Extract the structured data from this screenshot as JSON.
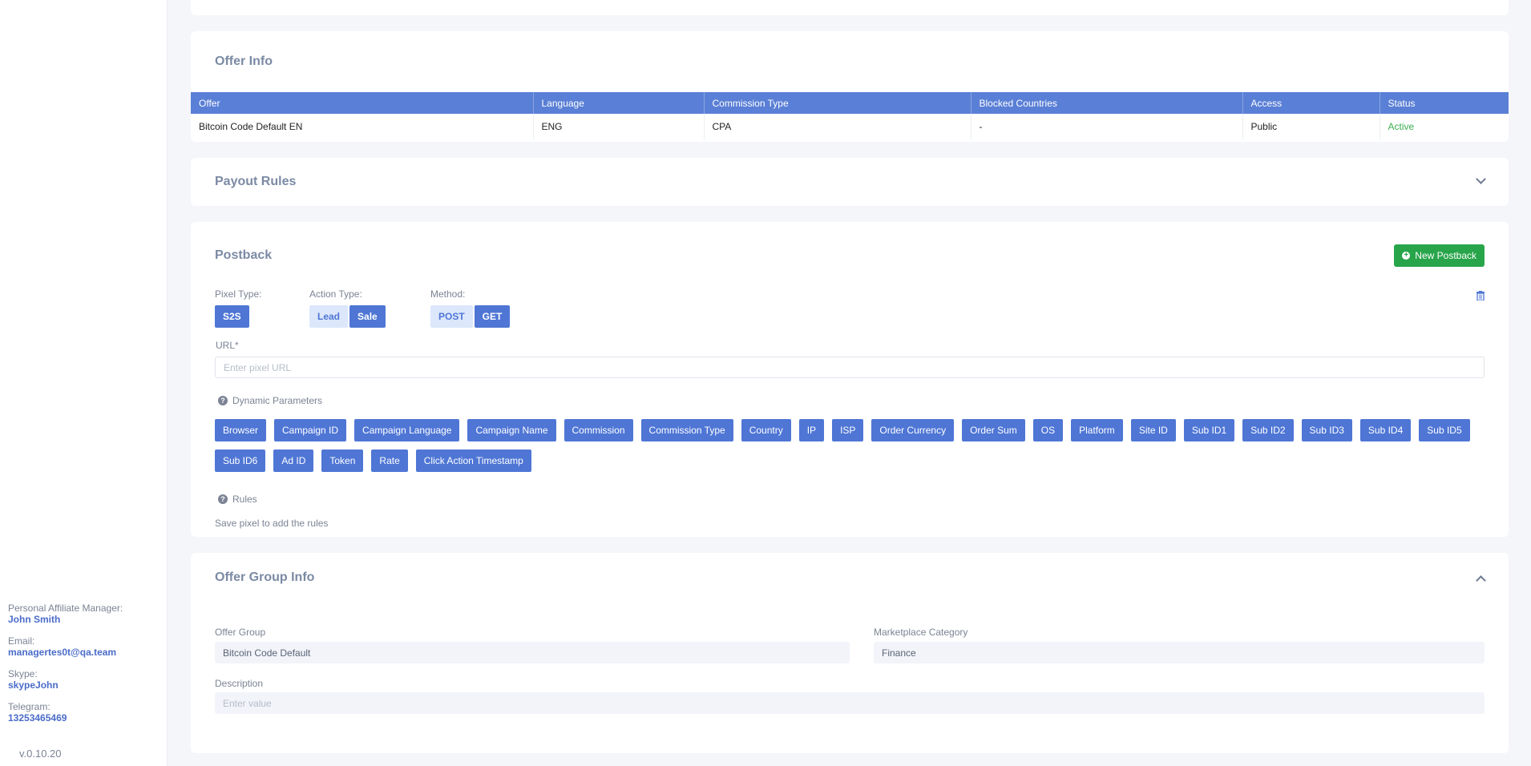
{
  "sidebar": {
    "manager": [
      {
        "label": "Personal Affiliate Manager:",
        "value": "John Smith"
      },
      {
        "label": "Email:",
        "value": "managertes0t@qa.team"
      },
      {
        "label": "Skype:",
        "value": "skypeJohn"
      },
      {
        "label": "Telegram:",
        "value": "13253465469"
      }
    ],
    "version": "v.0.10.20"
  },
  "offer_info": {
    "title": "Offer Info",
    "columns": [
      "Offer",
      "Language",
      "Commission Type",
      "Blocked Countries",
      "Access",
      "Status"
    ],
    "row": [
      "Bitcoin Code Default EN",
      "ENG",
      "CPA",
      "-",
      "Public",
      "Active"
    ],
    "status_color": "#3cae4f"
  },
  "payout_rules": {
    "title": "Payout Rules",
    "icon": "chevron-down-icon"
  },
  "postback": {
    "title": "Postback",
    "new_button": "New Postback",
    "pixel_type_label": "Pixel Type:",
    "pixel_type_options": [
      "S2S"
    ],
    "action_type_label": "Action Type:",
    "action_type_options": [
      "Lead",
      "Sale"
    ],
    "action_type_selected": "Sale",
    "method_label": "Method:",
    "method_options": [
      "POST",
      "GET"
    ],
    "method_selected": "GET",
    "url_label": "URL*",
    "url_placeholder": "Enter pixel URL",
    "url_value": "",
    "dynamic_params_label": "Dynamic Parameters",
    "dynamic_params": [
      "Browser",
      "Campaign ID",
      "Campaign Language",
      "Campaign Name",
      "Commission",
      "Commission Type",
      "Country",
      "IP",
      "ISP",
      "Order Currency",
      "Order Sum",
      "OS",
      "Platform",
      "Site ID",
      "Sub ID1",
      "Sub ID2",
      "Sub ID3",
      "Sub ID4",
      "Sub ID5",
      "Sub ID6",
      "Ad ID",
      "Token",
      "Rate",
      "Click Action Timestamp"
    ],
    "rules_label": "Rules",
    "rules_note": "Save pixel to add the rules"
  },
  "offer_group": {
    "title": "Offer Group Info",
    "icon": "chevron-up-icon",
    "group_label": "Offer Group",
    "group_value": "Bitcoin Code Default",
    "category_label": "Marketplace Category",
    "category_value": "Finance",
    "description_label": "Description",
    "description_placeholder": "Enter value"
  },
  "colors": {
    "primary": "#4f76d5",
    "table_header": "#5a7fd6",
    "success": "#28a54a",
    "muted": "#7b8394"
  }
}
